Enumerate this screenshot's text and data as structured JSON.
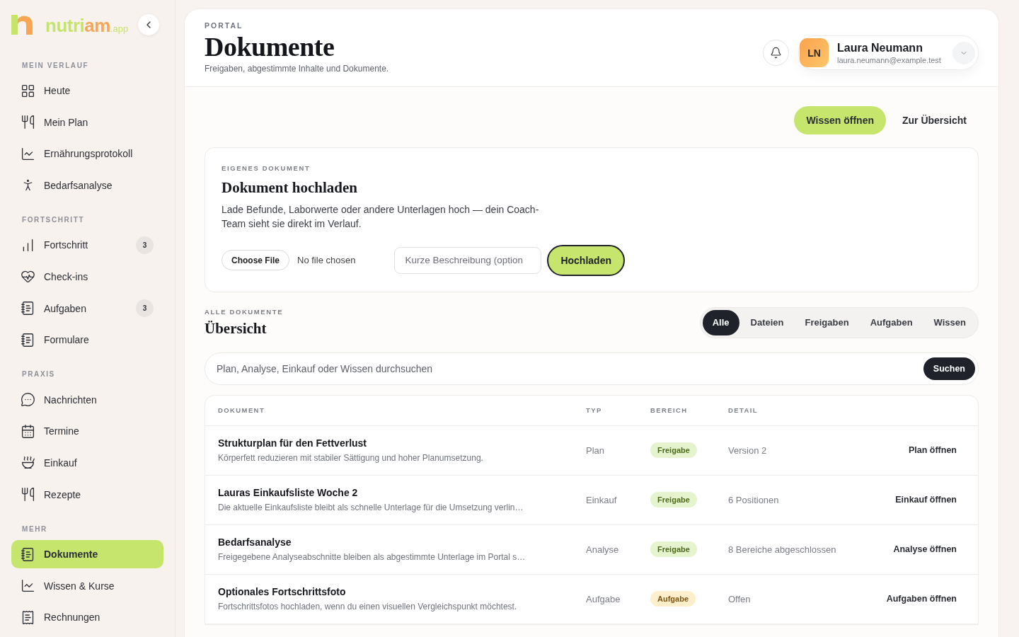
{
  "brand": {
    "name_start": "nutri",
    "name_end": "am",
    "domain": ".app"
  },
  "sidebar": {
    "sections": [
      {
        "title": "MEIN VERLAUF",
        "items": [
          {
            "label": "Heute",
            "selected": false
          },
          {
            "label": "Mein Plan",
            "selected": false
          },
          {
            "label": "Ernährungsprotokoll",
            "selected": false
          },
          {
            "label": "Bedarfsanalyse",
            "selected": false
          }
        ]
      },
      {
        "title": "FORTSCHRITT",
        "items": [
          {
            "label": "Fortschritt",
            "selected": false,
            "badge": "3"
          },
          {
            "label": "Check-ins",
            "selected": false
          },
          {
            "label": "Aufgaben",
            "selected": false,
            "badge": "3"
          },
          {
            "label": "Formulare",
            "selected": false
          }
        ]
      },
      {
        "title": "PRAXIS",
        "items": [
          {
            "label": "Nachrichten",
            "selected": false
          },
          {
            "label": "Termine",
            "selected": false
          },
          {
            "label": "Einkauf",
            "selected": false
          },
          {
            "label": "Rezepte",
            "selected": false
          }
        ]
      },
      {
        "title": "MEHR",
        "items": [
          {
            "label": "Dokumente",
            "selected": true
          },
          {
            "label": "Wissen & Kurse",
            "selected": false
          },
          {
            "label": "Rechnungen",
            "selected": false
          }
        ]
      }
    ]
  },
  "header": {
    "eyebrow": "PORTAL",
    "title": "Dokumente",
    "subtitle": "Freigaben, abgestimmte Inhalte und Dokumente.",
    "user": {
      "initials": "LN",
      "name": "Laura Neumann",
      "email": "laura.neumann@example.test"
    }
  },
  "actions": [
    {
      "label": "Wissen öffnen",
      "kind": "primary"
    },
    {
      "label": "Zur Übersicht",
      "kind": "plain"
    }
  ],
  "upload": {
    "eyebrow": "EIGENES DOKUMENT",
    "title": "Dokument hochladen",
    "text": "Lade Befunde, Laborwerte oder andere Unterlagen hoch — dein Coach-Team sieht sie direkt im Verlauf.",
    "file_button": "Choose File",
    "file_status": "No file chosen",
    "description_placeholder": "Kurze Beschreibung (option",
    "submit": "Hochladen"
  },
  "overview": {
    "eyebrow": "ALLE DOKUMENTE",
    "title": "Übersicht",
    "filters": [
      {
        "label": "Alle",
        "selected": true
      },
      {
        "label": "Dateien",
        "selected": false
      },
      {
        "label": "Freigaben",
        "selected": false
      },
      {
        "label": "Aufgaben",
        "selected": false
      },
      {
        "label": "Wissen",
        "selected": false
      }
    ],
    "search_placeholder": "Plan, Analyse, Einkauf oder Wissen durchsuchen",
    "search_button": "Suchen"
  },
  "table": {
    "columns": [
      "DOKUMENT",
      "TYP",
      "BEREICH",
      "DETAIL"
    ],
    "rows": [
      {
        "title": "Strukturplan für den Fettverlust",
        "description": "Körperfett reduzieren mit stabiler Sättigung und hoher Planumsetzung.",
        "type": "Plan",
        "area": {
          "label": "Freigabe",
          "kind": "release"
        },
        "detail": "Version 2",
        "action": "Plan öffnen"
      },
      {
        "title": "Lauras Einkaufsliste Woche 2",
        "description": "Die aktuelle Einkaufsliste bleibt als schnelle Unterlage für die Umsetzung verlin…",
        "type": "Einkauf",
        "area": {
          "label": "Freigabe",
          "kind": "release"
        },
        "detail": "6 Positionen",
        "action": "Einkauf öffnen"
      },
      {
        "title": "Bedarfsanalyse",
        "description": "Freigegebene Analyseabschnitte bleiben als abgestimmte Unterlage im Portal s…",
        "type": "Analyse",
        "area": {
          "label": "Freigabe",
          "kind": "release"
        },
        "detail": "8 Bereiche abgeschlossen",
        "action": "Analyse öffnen"
      },
      {
        "title": "Optionales Fortschrittsfoto",
        "description": "Fortschrittsfotos hochladen, wenn du einen visuellen Vergleichspunkt möchtest.",
        "type": "Aufgabe",
        "area": {
          "label": "Aufgabe",
          "kind": "task"
        },
        "detail": "Offen",
        "action": "Aufgaben öffnen"
      }
    ]
  }
}
